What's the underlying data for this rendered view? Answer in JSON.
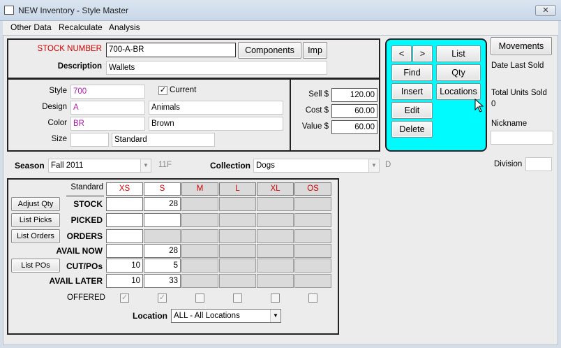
{
  "window": {
    "title": "NEW Inventory - Style Master",
    "close_glyph": "✕"
  },
  "menu": [
    "Other Data",
    "Recalculate",
    "Analysis"
  ],
  "stock": {
    "label": "STOCK NUMBER",
    "value": "700-A-BR",
    "components_label": "Components",
    "imp_label": "Imp"
  },
  "description": {
    "label": "Description",
    "value": "Wallets"
  },
  "style": {
    "label": "Style",
    "value": "700",
    "current_label": "Current",
    "current_checked": true
  },
  "design": {
    "label": "Design",
    "code": "A",
    "name": "Animals"
  },
  "color": {
    "label": "Color",
    "code": "BR",
    "name": "Brown"
  },
  "size": {
    "label": "Size",
    "code": "",
    "name": "Standard"
  },
  "pricing": {
    "sell_label": "Sell $",
    "sell": "120.00",
    "cost_label": "Cost $",
    "cost": "60.00",
    "value_label": "Value $",
    "value": "60.00"
  },
  "nav": {
    "prev": "<",
    "next": ">",
    "list": "List",
    "find": "Find",
    "qty": "Qty",
    "insert": "Insert",
    "locations": "Locations",
    "edit": "Edit",
    "delete": "Delete"
  },
  "right_panel": {
    "movements": "Movements",
    "date_last_sold_label": "Date Last Sold",
    "total_units_label": "Total Units Sold",
    "total_units_value": "0",
    "nickname_label": "Nickname",
    "nickname_value": "",
    "division_label": "Division",
    "division_value": ""
  },
  "season": {
    "label": "Season",
    "value": "Fall  2011",
    "code": "11F"
  },
  "collection": {
    "label": "Collection",
    "value": "Dogs",
    "code": "D"
  },
  "grid": {
    "size_set_label": "Standard",
    "sizes": [
      "XS",
      "S",
      "M",
      "L",
      "XL",
      "OS"
    ],
    "rows": [
      {
        "label": "STOCK",
        "values": [
          "",
          "28",
          "",
          "",
          "",
          ""
        ]
      },
      {
        "label": "PICKED",
        "values": [
          "",
          "",
          "",
          "",
          "",
          ""
        ]
      },
      {
        "label": "ORDERS",
        "values": [
          "",
          "",
          "",
          "",
          "",
          ""
        ]
      },
      {
        "label": "AVAIL NOW",
        "values": [
          "",
          "28",
          "",
          "",
          "",
          ""
        ]
      },
      {
        "label": "CUT/POs",
        "values": [
          "10",
          "5",
          "",
          "",
          "",
          ""
        ]
      },
      {
        "label": "AVAIL LATER",
        "values": [
          "10",
          "33",
          "",
          "",
          "",
          ""
        ]
      }
    ],
    "offered_label": "OFFERED",
    "offered": [
      true,
      true,
      false,
      false,
      false,
      false
    ]
  },
  "side_buttons": {
    "adjust_qty": "Adjust Qty",
    "list_picks": "List Picks",
    "list_orders": "List Orders",
    "list_pos": "List POs"
  },
  "location": {
    "label": "Location",
    "value": "ALL - All Locations"
  },
  "icons": {
    "checkmark": "✓",
    "dropdown": "▼"
  }
}
